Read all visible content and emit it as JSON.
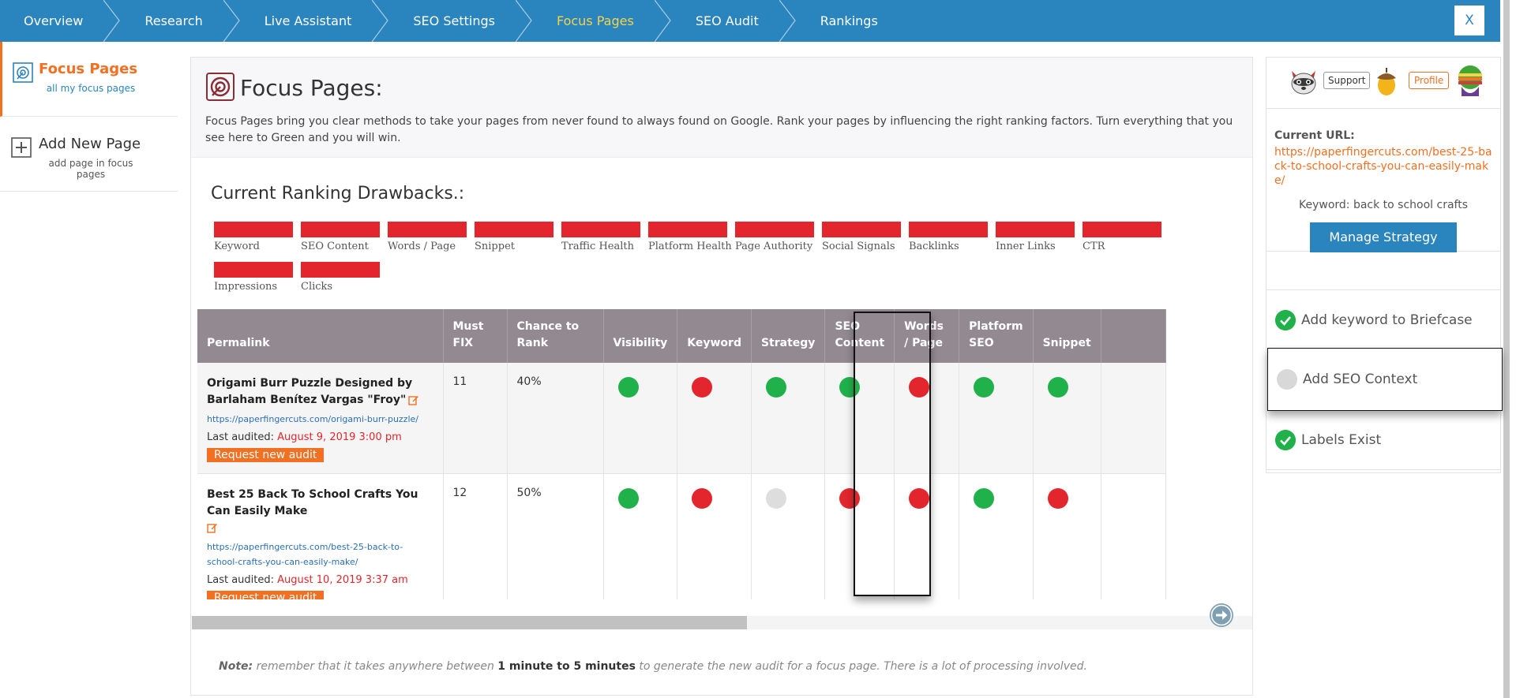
{
  "nav": {
    "items": [
      {
        "label": "Overview",
        "active": false
      },
      {
        "label": "Research",
        "active": false
      },
      {
        "label": "Live Assistant",
        "active": false
      },
      {
        "label": "SEO Settings",
        "active": false
      },
      {
        "label": "Focus Pages",
        "active": true
      },
      {
        "label": "SEO Audit",
        "active": false
      },
      {
        "label": "Rankings",
        "active": false
      }
    ],
    "close_label": "X"
  },
  "sidebar": {
    "items": [
      {
        "title": "Focus Pages",
        "subtitle": "all my focus pages",
        "icon": "focus-target-icon",
        "active": true
      },
      {
        "title": "Add New Page",
        "subtitle": "add page in focus pages",
        "icon": "plus-box-icon",
        "active": false
      }
    ]
  },
  "header": {
    "title": "Focus Pages:",
    "description": "Focus Pages bring you clear methods to take your pages from never found to always found on Google. Rank your pages by influencing the right ranking factors. Turn everything that you see here to Green and you will win."
  },
  "drawbacks": {
    "title": "Current Ranking Drawbacks.:",
    "bar_color": "#e3262d",
    "items": [
      "Keyword",
      "SEO Content",
      "Words / Page",
      "Snippet",
      "Traffic Health",
      "Platform Health",
      "Page Authority",
      "Social Signals",
      "Backlinks",
      "Inner Links",
      "CTR",
      "Impressions",
      "Clicks"
    ]
  },
  "table": {
    "columns": [
      "Permalink",
      "Must FIX",
      "Chance to Rank",
      "Visibility",
      "Keyword",
      "Strategy",
      "SEO Content",
      "Words / Page",
      "Platform SEO",
      "Snippet"
    ],
    "audit_button": "Request new audit",
    "last_audited_label": "Last audited:",
    "rows": [
      {
        "title": "Origami Burr Puzzle Designed by Barlaham Benítez Vargas \"Froy\"",
        "url": "https://paperfingercuts.com/origami-burr-puzzle/",
        "last_audited": "August 9, 2019 3:00 pm",
        "must_fix": "11",
        "chance": "40%",
        "statuses": [
          "green",
          "red",
          "green",
          "green",
          "red",
          "green",
          "green"
        ]
      },
      {
        "title": "Best 25 Back To School Crafts You Can Easily Make",
        "url": "https://paperfingercuts.com/best-25-back-to-school-crafts-you-can-easily-make/",
        "last_audited": "August 10, 2019 3:37 am",
        "must_fix": "12",
        "chance": "50%",
        "statuses": [
          "green",
          "red",
          "gray",
          "red",
          "red",
          "green",
          "red"
        ]
      }
    ]
  },
  "note": {
    "prefix": "Note:",
    "text1": " remember that it takes anywhere between ",
    "bold": "1 minute to 5 minutes",
    "text2": " to generate the new audit for a focus page. There is a lot of processing involved."
  },
  "right_panel": {
    "support_label": "Support",
    "profile_label": "Profile",
    "current_url_label": "Current URL:",
    "current_url": "https://paperfingercuts.com/best-25-back-to-school-crafts-you-can-easily-make/",
    "keyword_text": "Keyword: back to school crafts",
    "manage_button": "Manage Strategy",
    "tasks": [
      {
        "label": "Add keyword to Briefcase",
        "done": true
      },
      {
        "label": "Add SEO Context",
        "done": false
      },
      {
        "label": "Labels Exist",
        "done": true
      }
    ]
  },
  "colors": {
    "nav_bg": "#2a84bd",
    "accent_orange": "#f36f21",
    "status_green": "#21b14b",
    "status_red": "#e3262d",
    "table_header_bg": "#938a91"
  }
}
